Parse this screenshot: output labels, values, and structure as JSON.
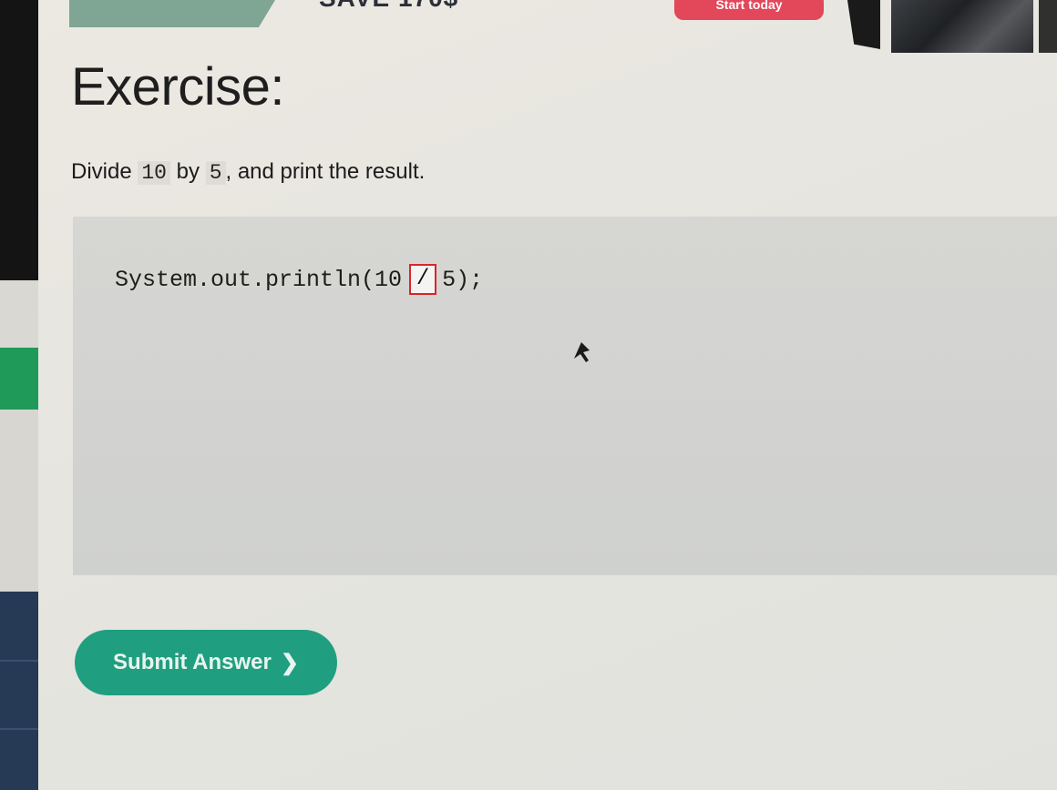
{
  "banner": {
    "promo_text": "SAVE 170$",
    "cta_label": "Start today"
  },
  "exercise": {
    "title": "Exercise:",
    "instruction_prefix": "Divide",
    "instruction_num1": "10",
    "instruction_mid": "by",
    "instruction_num2": "5",
    "instruction_suffix": ", and print the result."
  },
  "code": {
    "before": "System.out.println(10",
    "input_value": "/",
    "after": "5);"
  },
  "actions": {
    "submit_label": "Submit Answer",
    "submit_icon": "chevron-right-icon"
  },
  "colors": {
    "accent_green": "#1f9f80",
    "cta_red": "#e2475a",
    "input_border": "#d8262a"
  }
}
